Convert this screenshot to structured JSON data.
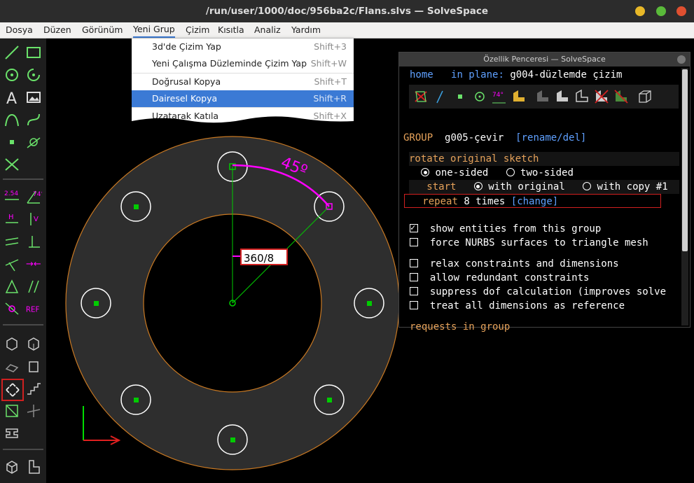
{
  "window": {
    "title": "/run/user/1000/doc/956ba2c/Flans.slvs — SolveSpace"
  },
  "menu": [
    "Dosya",
    "Düzen",
    "Görünüm",
    "Yeni Grup",
    "Çizim",
    "Kısıtla",
    "Analiz",
    "Yardım"
  ],
  "dropdown": {
    "items": [
      {
        "label": "3d'de Çizim Yap",
        "shortcut": "Shift+3"
      },
      {
        "label": "Yeni Çalışma Düzleminde Çizim Yap",
        "shortcut": "Shift+W"
      },
      {
        "label": "Doğrusal Kopya",
        "shortcut": "Shift+T"
      },
      {
        "label": "Dairesel Kopya",
        "shortcut": "Shift+R"
      },
      {
        "label": "Uzatarak Katıla",
        "shortcut": "Shift+X"
      }
    ]
  },
  "canvas": {
    "angle_label": "45º",
    "edit_value": "360/8"
  },
  "toolbar": {
    "ref_label": "REF",
    "dim_label": "2.54",
    "angle_label": "74°",
    "h_label": "H",
    "v_label": "V"
  },
  "property_window": {
    "title": "Özellik Penceresi — SolveSpace",
    "home": "home",
    "in_plane_label": "in plane:",
    "in_plane_value": "g004-düzlemde çizim",
    "group_label": "GROUP",
    "group_name": "g005-çevir",
    "rename_del": "[rename/del]",
    "section": "rotate original sketch",
    "one_sided": "one-sided",
    "two_sided": "two-sided",
    "start_label": "start",
    "with_original": "with original",
    "with_copy": "with copy #1",
    "repeat_label": "repeat",
    "repeat_value": "8 times",
    "change": "[change]",
    "options": [
      {
        "label": "show entities from this group",
        "checked": true
      },
      {
        "label": "force NURBS surfaces to triangle mesh",
        "checked": false
      },
      {
        "label": "relax constraints and dimensions",
        "checked": false
      },
      {
        "label": "allow redundant constraints",
        "checked": false
      },
      {
        "label": "suppress dof calculation (improves solve",
        "checked": false
      },
      {
        "label": "treat all dimensions as reference",
        "checked": false
      }
    ],
    "requests": "requests in group"
  },
  "colors": {
    "accent": "#3b7ad5",
    "constraint": "#ff00ff",
    "construction": "#00cc00",
    "outline": "#c87822",
    "fill": "#2e2e2e",
    "highlight_box": "#d02020"
  }
}
